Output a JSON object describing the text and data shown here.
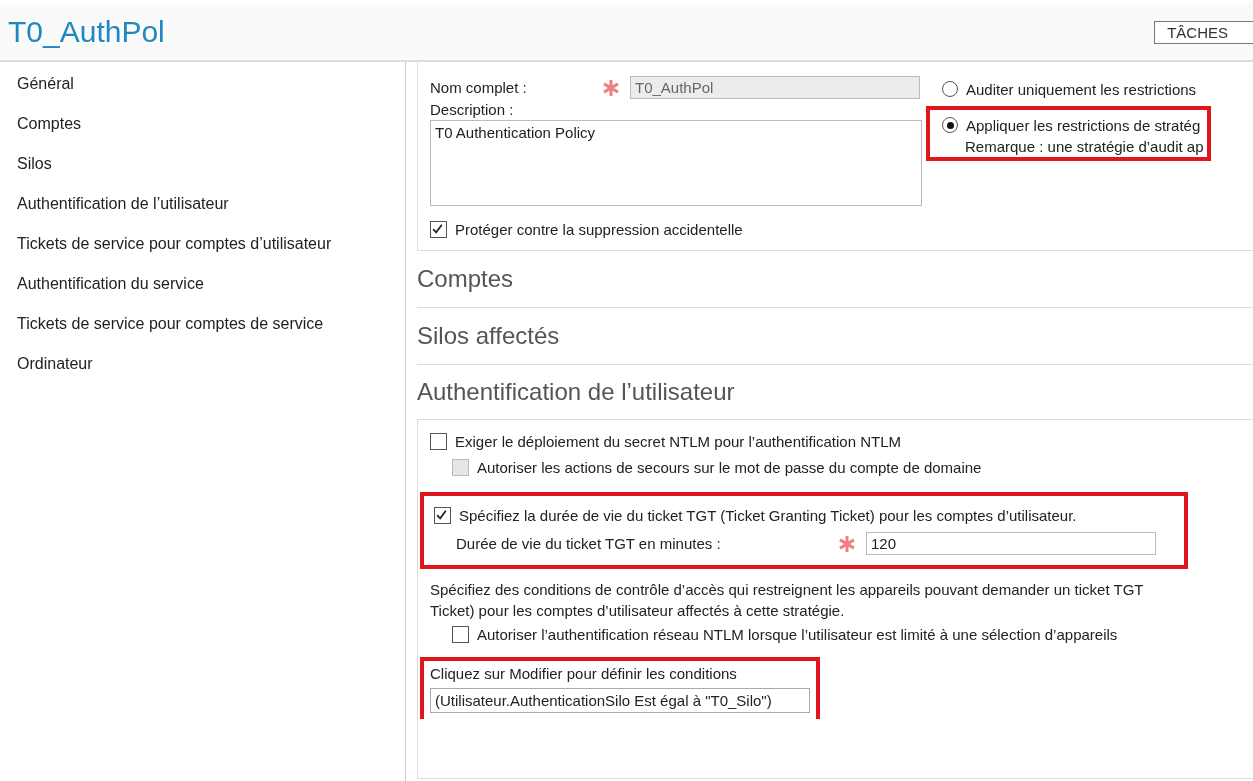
{
  "title": "T0_AuthPol",
  "tasks_button": "TÂCHES",
  "nav": [
    {
      "label": "Général"
    },
    {
      "label": "Comptes"
    },
    {
      "label": "Silos"
    },
    {
      "label": "Authentification de l’utilisateur"
    },
    {
      "label": "Tickets de service pour comptes d’utilisateur"
    },
    {
      "label": "Authentification du service"
    },
    {
      "label": "Tickets de service pour comptes de service"
    },
    {
      "label": "Ordinateur"
    }
  ],
  "general": {
    "name_label": "Nom complet :",
    "name_value": "T0_AuthPol",
    "description_label": "Description :",
    "description_value": "T0 Authentication Policy",
    "protect": {
      "label": "Protéger contre la suppression accidentelle",
      "checked": true
    },
    "modes": [
      {
        "label": "Auditer uniquement les restrictions",
        "selected": false,
        "highlighted": false
      },
      {
        "label": "Appliquer les restrictions de stratég",
        "note": "Remarque : une stratégie d’audit ap",
        "selected": true,
        "highlighted": true
      }
    ]
  },
  "sections": [
    {
      "title": "Comptes"
    },
    {
      "title": "Silos affectés"
    },
    {
      "title": "Authentification de l’utilisateur"
    }
  ],
  "user_auth": {
    "ntlm": {
      "label": "Exiger le déploiement du secret NTLM pour l’authentification NTLM",
      "checked": false
    },
    "fallback": {
      "label": "Autoriser les actions de secours sur le mot de passe du compte de domaine",
      "checked": false,
      "disabled": true
    },
    "tgt": {
      "label": "Spécifiez la durée de vie du ticket TGT (Ticket Granting Ticket) pour les comptes d’utilisateur.",
      "checked": true,
      "highlighted": true,
      "field_label": "Durée de vie du ticket TGT en minutes :",
      "field_value": "120"
    },
    "access_text": [
      "Spécifiez des conditions de contrôle d’accès qui restreignent les appareils pouvant demander un ticket TGT",
      "Ticket) pour les comptes d’utilisateur affectés à cette stratégie."
    ],
    "ntlm_devices": {
      "label": "Autoriser l’authentification réseau NTLM lorsque l’utilisateur est limité à une sélection d’appareils",
      "checked": false
    },
    "conditions": {
      "label": "Cliquez sur Modifier pour définir les conditions",
      "value": "(Utilisateur.AuthenticationSilo Est égal à \"T0_Silo\")",
      "highlighted": true
    }
  }
}
